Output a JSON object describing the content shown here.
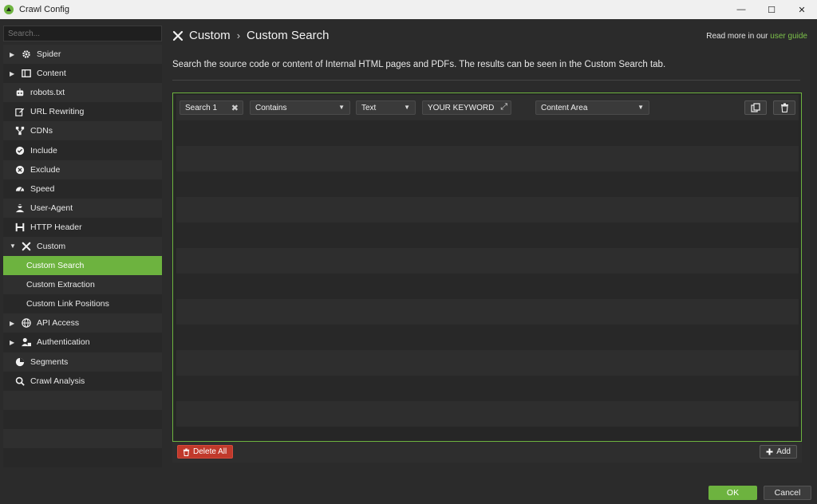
{
  "window": {
    "title": "Crawl Config",
    "minimize": "—",
    "maximize": "☐",
    "close": "✕"
  },
  "sidebar": {
    "search_placeholder": "Search...",
    "items": [
      {
        "label": "Spider",
        "icon": "gear-icon",
        "caret": "▶"
      },
      {
        "label": "Content",
        "icon": "content-icon",
        "caret": "▶"
      },
      {
        "label": "robots.txt",
        "icon": "robot-icon"
      },
      {
        "label": "URL Rewriting",
        "icon": "edit-icon"
      },
      {
        "label": "CDNs",
        "icon": "network-icon"
      },
      {
        "label": "Include",
        "icon": "check-circle-icon"
      },
      {
        "label": "Exclude",
        "icon": "x-circle-icon"
      },
      {
        "label": "Speed",
        "icon": "speedometer-icon"
      },
      {
        "label": "User-Agent",
        "icon": "user-agent-icon"
      },
      {
        "label": "HTTP Header",
        "icon": "header-icon"
      },
      {
        "label": "Custom",
        "icon": "tools-icon",
        "caret": "▼"
      },
      {
        "label": "Custom Search",
        "sub": true,
        "active": true
      },
      {
        "label": "Custom Extraction",
        "sub": true
      },
      {
        "label": "Custom Link Positions",
        "sub": true
      },
      {
        "label": "API Access",
        "icon": "globe-icon",
        "caret": "▶"
      },
      {
        "label": "Authentication",
        "icon": "user-lock-icon",
        "caret": "▶"
      },
      {
        "label": "Segments",
        "icon": "pie-chart-icon"
      },
      {
        "label": "Crawl Analysis",
        "icon": "search-icon"
      }
    ]
  },
  "header": {
    "breadcrumb_root": "Custom",
    "breadcrumb_sep": "›",
    "breadcrumb_current": "Custom Search",
    "read_more_prefix": "Read more in our ",
    "read_more_link": "user guide",
    "description": "Search the source code or content of Internal HTML pages and PDFs. The results can be seen in the Custom Search tab."
  },
  "search_row": {
    "name": "Search 1",
    "match_type": "Contains",
    "mode": "Text",
    "keyword": "YOUR KEYWORD",
    "scope": "Content Area"
  },
  "actions": {
    "delete_all": "Delete All",
    "add": "Add",
    "ok": "OK",
    "cancel": "Cancel"
  },
  "colors": {
    "accent": "#6db33f",
    "danger": "#c0392b",
    "background": "#2b2b2b"
  }
}
